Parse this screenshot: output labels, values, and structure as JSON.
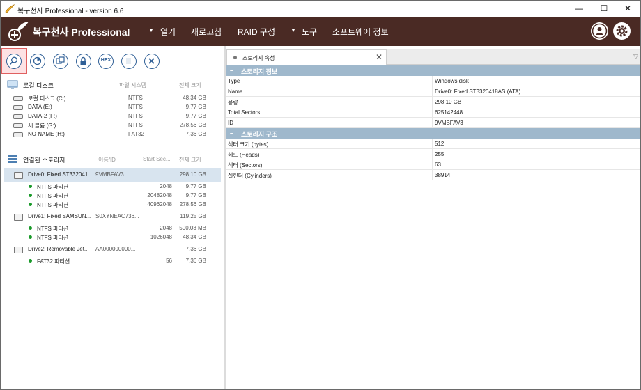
{
  "window": {
    "title": "복구천사 Professional - version 6.6",
    "minimize_glyph": "—",
    "maximize_glyph": "☐",
    "close_glyph": "✕"
  },
  "menubar": {
    "brand": "복구천사 Professional",
    "items": [
      {
        "label": "열기",
        "caret": true
      },
      {
        "label": "새로고침",
        "caret": false
      },
      {
        "label": "RAID 구성",
        "caret": true
      },
      {
        "label": "도구",
        "caret": false
      },
      {
        "label": "소프트웨어 정보",
        "caret": false
      }
    ],
    "caret_glyph": "▼"
  },
  "toolbar": {
    "hex_label": "HEX",
    "icons": [
      "search-icon",
      "scan-icon",
      "image-icon",
      "lock-icon",
      "hex-icon",
      "list-icon",
      "close-icon"
    ]
  },
  "local": {
    "heading": "로컬 디스크",
    "col_fs": "파일 시스템",
    "col_size": "전체 크기",
    "rows": [
      {
        "name": "로컬 디스크 (C:)",
        "fs": "NTFS",
        "size": "48.34 GB"
      },
      {
        "name": "DATA (E:)",
        "fs": "NTFS",
        "size": "9.77 GB"
      },
      {
        "name": "DATA-2 (F:)",
        "fs": "NTFS",
        "size": "9.77 GB"
      },
      {
        "name": "새 볼륨 (G:)",
        "fs": "NTFS",
        "size": "278.56 GB"
      },
      {
        "name": "NO NAME (H:)",
        "fs": "FAT32",
        "size": "7.36 GB"
      }
    ]
  },
  "storage": {
    "heading": "연결된 스토리지",
    "col_name": "이름/ID",
    "col_start": "Start Sec...",
    "col_size": "전체 크기",
    "drives": [
      {
        "name": "Drive0: Fixed ST332041...",
        "id": "9VMBFAV3",
        "size": "298.10 GB",
        "parts": [
          {
            "name": "NTFS 파티션",
            "start": "2048",
            "size": "9.77 GB"
          },
          {
            "name": "NTFS 파티션",
            "start": "20482048",
            "size": "9.77 GB"
          },
          {
            "name": "NTFS 파티션",
            "start": "40962048",
            "size": "278.56 GB"
          }
        ]
      },
      {
        "name": "Drive1: Fixed SAMSUN...",
        "id": "S0XYNEAC736...",
        "size": "119.25 GB",
        "parts": [
          {
            "name": "NTFS 파티션",
            "start": "2048",
            "size": "500.03 MB"
          },
          {
            "name": "NTFS 파티션",
            "start": "1026048",
            "size": "48.34 GB"
          }
        ]
      },
      {
        "name": "Drive2: Removable Jet...",
        "id": "AA000000000...",
        "size": "7.36 GB",
        "parts": [
          {
            "name": "FAT32 파티션",
            "start": "56",
            "size": "7.36 GB"
          }
        ]
      }
    ]
  },
  "right": {
    "tab_label": "스토리지 속성",
    "tab_close": "✕",
    "tab_menu": "▽",
    "groups": [
      {
        "title": "스토리지 정보",
        "rows": [
          {
            "k": "Type",
            "v": "Windows disk"
          },
          {
            "k": "Name",
            "v": "Drive0: Fixed ST3320418AS (ATA)"
          },
          {
            "k": "용량",
            "v": "298.10 GB"
          },
          {
            "k": "Total Sectors",
            "v": "625142448"
          },
          {
            "k": "ID",
            "v": "9VMBFAV3"
          }
        ]
      },
      {
        "title": "스토리지 구조",
        "rows": [
          {
            "k": "섹터 크기 (bytes)",
            "v": "512"
          },
          {
            "k": "헤드 (Heads)",
            "v": "255"
          },
          {
            "k": "섹터 (Sectors)",
            "v": "63"
          },
          {
            "k": "실린더 (Cylinders)",
            "v": "38914"
          }
        ]
      }
    ],
    "collapse_glyph": "–"
  }
}
